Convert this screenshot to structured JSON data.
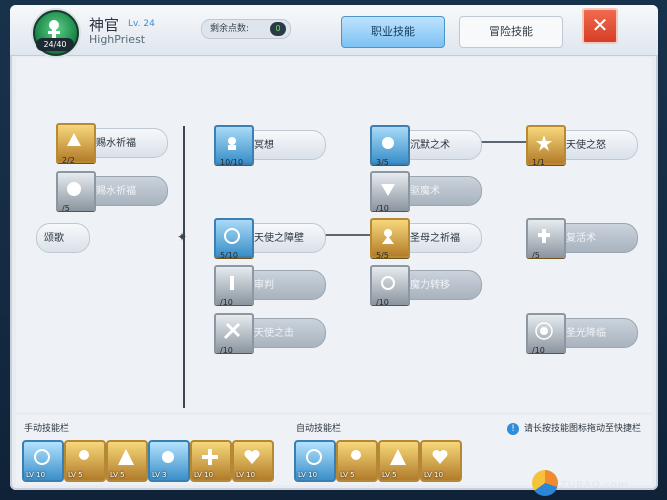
{
  "header": {
    "class_name": "神官",
    "level_label": "Lv. 24",
    "subtitle": "HighPriest",
    "job_level": "24/40",
    "points_label": "剩余点数:",
    "points_value": "0",
    "tab_job": "职业技能",
    "tab_adventure": "冒险技能",
    "close_label": "✕"
  },
  "skills": {
    "s1": {
      "name": "赐水祈福",
      "level": "2/2"
    },
    "s2": {
      "name": "赐水祈福",
      "level": "/5"
    },
    "s3": {
      "name": "颂歌",
      "level": ""
    },
    "s4": {
      "name": "冥想",
      "level": "10/10"
    },
    "s5": {
      "name": "天使之障壁",
      "level": "5/10"
    },
    "s6": {
      "name": "审判",
      "level": "/10"
    },
    "s7": {
      "name": "天使之击",
      "level": "/10"
    },
    "s8": {
      "name": "沉默之术",
      "level": "3/5"
    },
    "s9": {
      "name": "驱魔术",
      "level": "/10"
    },
    "s10": {
      "name": "圣母之祈福",
      "level": "5/5"
    },
    "s11": {
      "name": "魔力转移",
      "level": "/10"
    },
    "s12": {
      "name": "天使之怒",
      "level": "1/1"
    },
    "s13": {
      "name": "复活术",
      "level": "/5"
    },
    "s14": {
      "name": "圣光降临",
      "level": "/10"
    }
  },
  "bottom": {
    "manual_title": "手动技能栏",
    "auto_title": "自动技能栏",
    "hint_text": "请长按技能图标拖动至快捷栏",
    "manual_slots": [
      "LV 10",
      "LV 5",
      "LV 5",
      "LV 3",
      "LV 10",
      "LV 10"
    ],
    "auto_slots": [
      "LV 10",
      "LV 5",
      "LV 5",
      "LV 10"
    ]
  },
  "watermark": {
    "text": "ZUBAO.com"
  },
  "colors": {
    "accent": "#3a8edc",
    "close": "#e04a30",
    "gold": "#d8a84a"
  }
}
